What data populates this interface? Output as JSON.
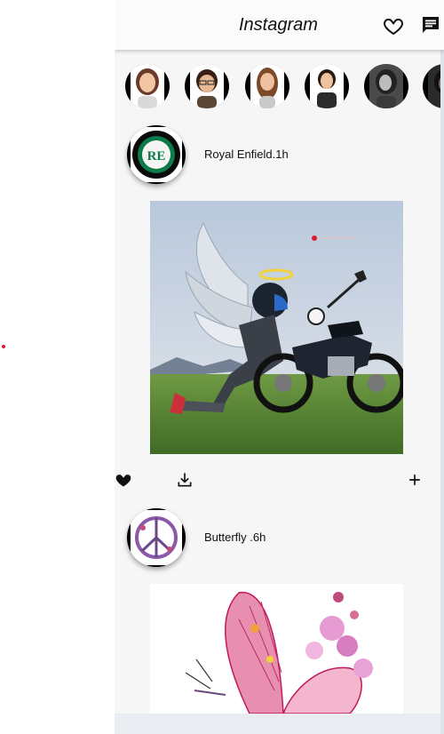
{
  "app": {
    "title": "Instagram"
  },
  "header": {
    "heart_icon": "heart-outline-icon",
    "chat_icon": "chat-bubble-icon"
  },
  "stories": [
    {
      "name": "story-1",
      "hair": "#6b3a2a",
      "skin": "#f2c6a4",
      "shirt": "#d9d9d9"
    },
    {
      "name": "story-2",
      "hair": "#3a1f14",
      "skin": "#e8b894",
      "shirt": "#5a4634"
    },
    {
      "name": "story-3",
      "hair": "#7a4a2a",
      "skin": "#f0c0a0",
      "shirt": "#c9c9c9"
    },
    {
      "name": "story-4",
      "hair": "#2a1a12",
      "skin": "#edc3a2",
      "shirt": "#2b2b2b"
    },
    {
      "name": "story-5",
      "hair": "#222222",
      "skin": "#bdbdbd",
      "shirt": "#3a3a3a"
    },
    {
      "name": "story-6",
      "hair": "#111111",
      "skin": "#7a6a64",
      "shirt": "#1a1a1a"
    }
  ],
  "posts": [
    {
      "user": "Royal Enfield.1h"
    },
    {
      "user": "Butterfly .6h"
    }
  ],
  "actions": {
    "like_icon": "heart-filled-icon",
    "download_icon": "download-icon",
    "add_icon": "plus-icon"
  },
  "colors": {
    "accent_red": "#e0182c",
    "logo_green": "#0d7a4a",
    "sky": "#b9c8dc",
    "grass": "#5e8a3a"
  }
}
